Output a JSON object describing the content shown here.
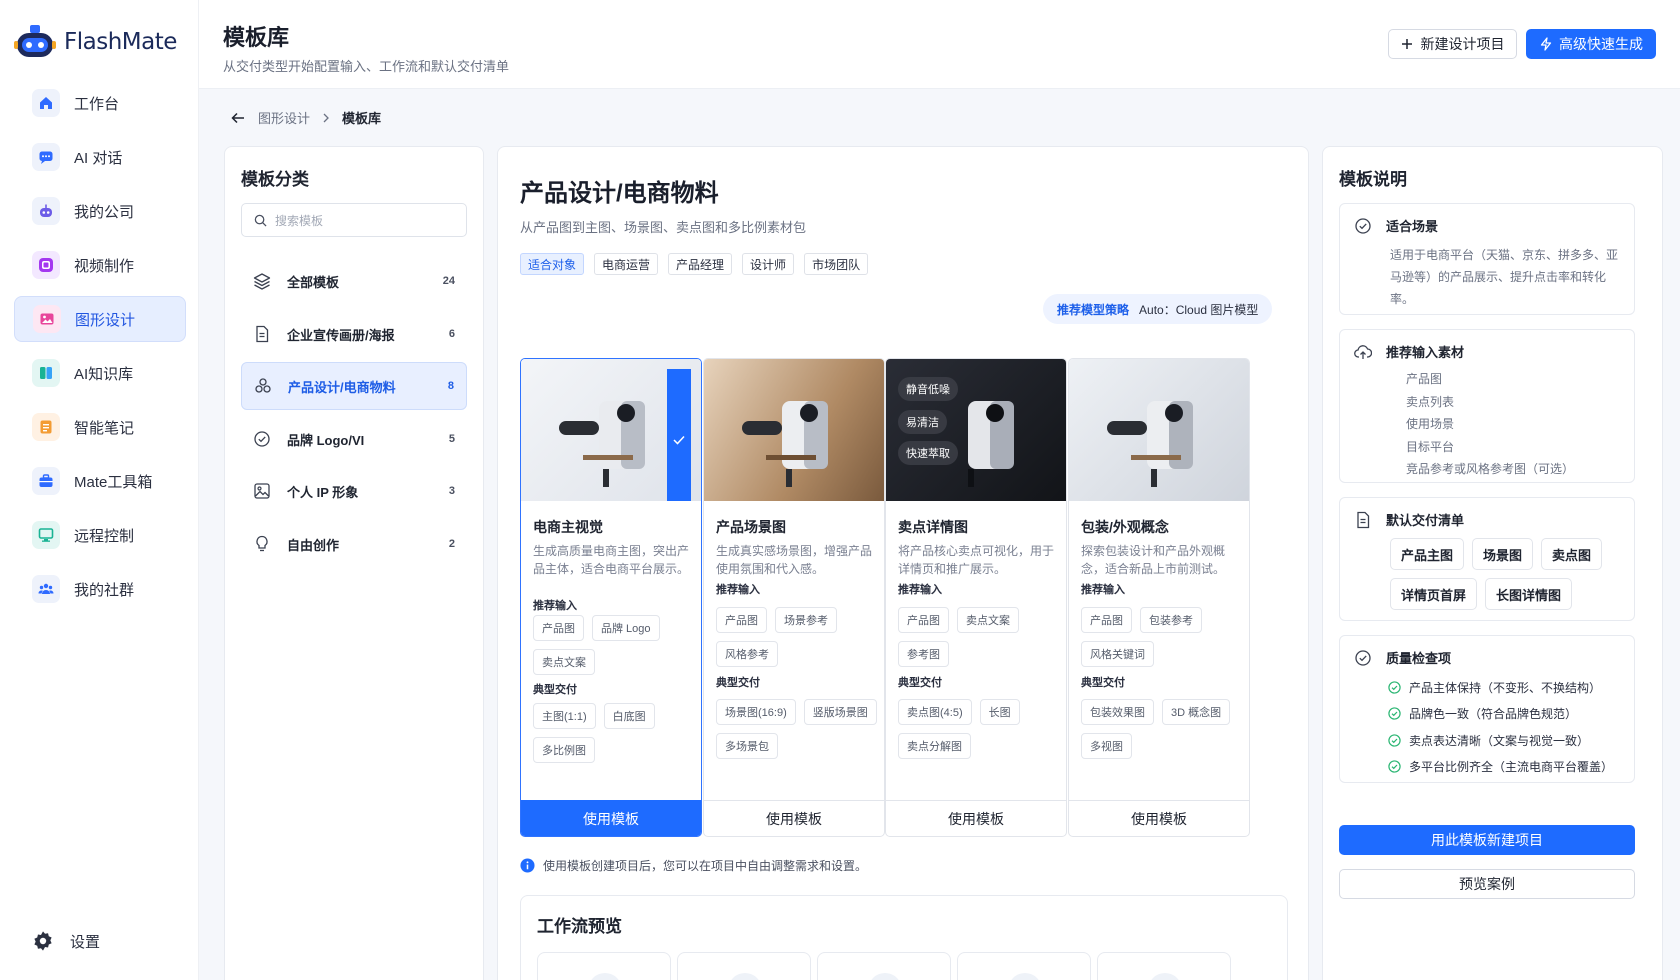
{
  "app": {
    "name": "FlashMate"
  },
  "sidebar": {
    "items": [
      {
        "label": "工作台",
        "icon": "home-icon"
      },
      {
        "label": "AI 对话",
        "icon": "chat-icon"
      },
      {
        "label": "我的公司",
        "icon": "robot-icon"
      },
      {
        "label": "视频制作",
        "icon": "video-icon"
      },
      {
        "label": "图形设计",
        "icon": "image-icon",
        "active": true
      },
      {
        "label": "AI知识库",
        "icon": "book-icon"
      },
      {
        "label": "智能笔记",
        "icon": "note-icon"
      },
      {
        "label": "Mate工具箱",
        "icon": "toolbox-icon"
      },
      {
        "label": "远程控制",
        "icon": "monitor-icon"
      },
      {
        "label": "我的社群",
        "icon": "community-icon"
      }
    ],
    "settings_label": "设置"
  },
  "header": {
    "title": "模板库",
    "subtitle": "从交付类型开始配置输入、工作流和默认交付清单",
    "new_project": "新建设计项目",
    "quick_generate": "高级快速生成"
  },
  "breadcrumb": {
    "parent": "图形设计",
    "current": "模板库"
  },
  "categories": {
    "title": "模板分类",
    "search_placeholder": "搜索模板",
    "items": [
      {
        "label": "全部模板",
        "count": "24",
        "icon": "layers-icon"
      },
      {
        "label": "企业宣传画册/海报",
        "count": "6",
        "icon": "document-icon"
      },
      {
        "label": "产品设计/电商物料",
        "count": "8",
        "icon": "grid-circles-icon",
        "active": true
      },
      {
        "label": "品牌 Logo/VI",
        "count": "5",
        "icon": "check-circle-icon"
      },
      {
        "label": "个人 IP 形象",
        "count": "3",
        "icon": "picture-icon"
      },
      {
        "label": "自由创作",
        "count": "2",
        "icon": "lightbulb-icon"
      }
    ]
  },
  "main": {
    "title": "产品设计/电商物料",
    "subtitle": "从产品图到主图、场景图、卖点图和多比例素材包",
    "audience_tags": [
      "适合对象",
      "电商运营",
      "产品经理",
      "设计师",
      "市场团队"
    ],
    "model_label": "推荐模型策略",
    "model_value": "Auto：Cloud 图片模型",
    "cards": [
      {
        "name": "电商主视觉",
        "desc": "生成高质量电商主图，突出产品主体，适合电商平台展示。",
        "input_title": "推荐输入",
        "inputs": [
          "产品图",
          "品牌 Logo",
          "卖点文案"
        ],
        "output_title": "典型交付",
        "outputs": [
          "主图(1:1)",
          "白底图",
          "多比例图"
        ],
        "button": "使用模板",
        "selected": true
      },
      {
        "name": "产品场景图",
        "desc": "生成真实感场景图，增强产品使用氛围和代入感。",
        "input_title": "推荐输入",
        "inputs": [
          "产品图",
          "场景参考",
          "风格参考"
        ],
        "output_title": "典型交付",
        "outputs": [
          "场景图(16:9)",
          "竖版场景图",
          "多场景包"
        ],
        "button": "使用模板"
      },
      {
        "name": "卖点详情图",
        "desc": "将产品核心卖点可视化，用于详情页和推广展示。",
        "input_title": "推荐输入",
        "inputs": [
          "产品图",
          "卖点文案",
          "参考图"
        ],
        "output_title": "典型交付",
        "outputs": [
          "卖点图(4:5)",
          "长图",
          "卖点分解图"
        ],
        "button": "使用模板",
        "overlay": [
          "静音低噪",
          "易清洁",
          "快速萃取"
        ]
      },
      {
        "name": "包装/外观概念",
        "desc": "探索包装设计和产品外观概念，适合新品上市前测试。",
        "input_title": "推荐输入",
        "inputs": [
          "产品图",
          "包装参考",
          "风格关键词"
        ],
        "output_title": "典型交付",
        "outputs": [
          "包装效果图",
          "3D 概念图",
          "多视图"
        ],
        "button": "使用模板"
      }
    ],
    "info_note": "使用模板创建项目后，您可以在项目中自由调整需求和设置。",
    "workflow_title": "工作流预览"
  },
  "details": {
    "title": "模板说明",
    "scene_title": "适合场景",
    "scene_text": "适用于电商平台（天猫、京东、拼多多、亚马逊等）的产品展示、提升点击率和转化率。",
    "inputs_title": "推荐输入素材",
    "inputs": [
      "产品图",
      "卖点列表",
      "使用场景",
      "目标平台",
      "竞品参考或风格参考图（可选）"
    ],
    "deliverables_title": "默认交付清单",
    "deliverables": [
      "产品主图",
      "场景图",
      "卖点图",
      "详情页首屏",
      "长图详情图"
    ],
    "quality_title": "质量检查项",
    "quality": [
      "产品主体保持（不变形、不换结构）",
      "品牌色一致（符合品牌色规范）",
      "卖点表达清晰（文案与视觉一致）",
      "多平台比例齐全（主流电商平台覆盖）"
    ],
    "create_button": "用此模板新建项目",
    "preview_button": "预览案例"
  },
  "colors": {
    "accent": "#1e6bff",
    "active_bg": "#e6eeff",
    "success": "#2bb673"
  }
}
